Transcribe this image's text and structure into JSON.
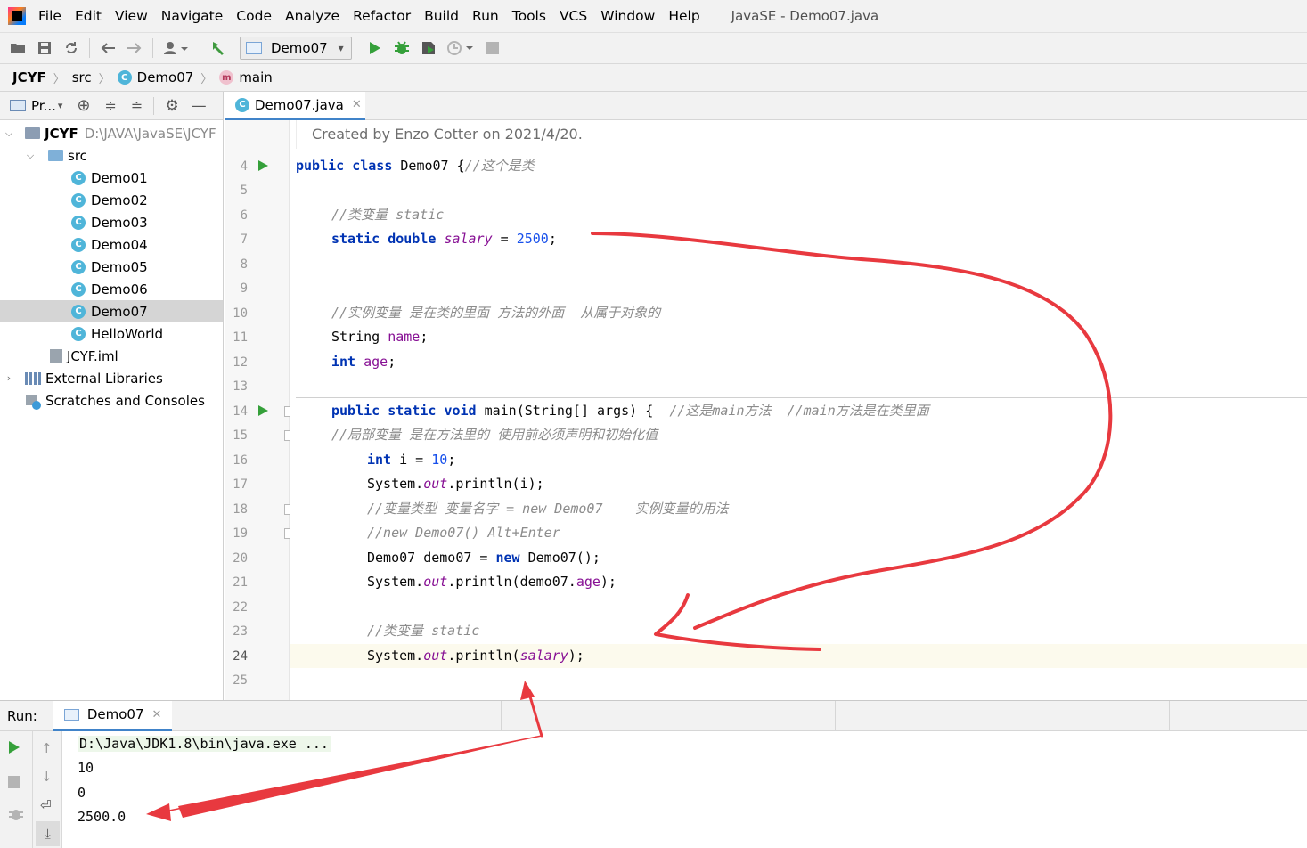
{
  "menubar": {
    "items": [
      "File",
      "Edit",
      "View",
      "Navigate",
      "Code",
      "Analyze",
      "Refactor",
      "Build",
      "Run",
      "Tools",
      "VCS",
      "Window",
      "Help"
    ],
    "window_title": "JavaSE - Demo07.java"
  },
  "toolbar": {
    "run_config": "Demo07"
  },
  "breadcrumb": [
    "JCYF",
    "src",
    "Demo07",
    "main"
  ],
  "project_panel": {
    "title": "Pr...",
    "tree": [
      {
        "label": "JCYF",
        "extra": "D:\\JAVA\\JavaSE\\JCYF",
        "icon": "module-folder-icon",
        "expanded": true
      },
      {
        "label": "src",
        "icon": "source-folder-icon",
        "expanded": true
      },
      {
        "label": "Demo01",
        "icon": "java-class-icon"
      },
      {
        "label": "Demo02",
        "icon": "java-class-icon"
      },
      {
        "label": "Demo03",
        "icon": "java-class-icon"
      },
      {
        "label": "Demo04",
        "icon": "java-class-icon"
      },
      {
        "label": "Demo05",
        "icon": "java-class-icon"
      },
      {
        "label": "Demo06",
        "icon": "java-class-icon"
      },
      {
        "label": "Demo07",
        "icon": "java-class-icon",
        "selected": true
      },
      {
        "label": "HelloWorld",
        "icon": "java-class-icon"
      },
      {
        "label": "JCYF.iml",
        "icon": "iml-file-icon"
      },
      {
        "label": "External Libraries",
        "icon": "library-icon",
        "collapsed": true
      },
      {
        "label": "Scratches and Consoles",
        "icon": "scratches-icon"
      }
    ]
  },
  "editor": {
    "tab": "Demo07.java",
    "credit": "Created by Enzo Cotter on 2021/4/20.",
    "line_numbers": [
      "4",
      "5",
      "6",
      "7",
      "8",
      "9",
      "10",
      "11",
      "12",
      "13",
      "14",
      "15",
      "16",
      "17",
      "18",
      "19",
      "20",
      "21",
      "22",
      "23",
      "24",
      "25"
    ],
    "lines": {
      "l4_kw1": "public",
      "l4_kw2": "class",
      "l4_name": " Demo07 {",
      "l4_cm": "//这个是类",
      "l6_cm": "//类变量 static",
      "l7_kw1": "static",
      "l7_kw2": "double",
      "l7_var": "salary",
      "l7_eq": " = ",
      "l7_num": "2500",
      "l7_end": ";",
      "l10_cm": "//实例变量 是在类的里面 方法的外面  从属于对象的",
      "l11_type": "String ",
      "l11_var": "name",
      "l11_end": ";",
      "l12_kw": "int",
      "l12_var": "age",
      "l12_end": ";",
      "l14_kw1": "public",
      "l14_kw2": "static",
      "l14_kw3": "void",
      "l14_sig": " main(String[] args) {  ",
      "l14_cm": "//这是main方法  //main方法是在类里面",
      "l15_cm": "//局部变量 是在方法里的 使用前必须声明和初始化值",
      "l16_kw": "int",
      "l16_mid": " i = ",
      "l16_num": "10",
      "l16_end": ";",
      "l17_a": "System.",
      "l17_out": "out",
      "l17_b": ".println(i);",
      "l18_cm": "//变量类型 变量名字 = new Demo07    实例变量的用法",
      "l19_cm": "//new Demo07() Alt+Enter",
      "l20_a": "Demo07 demo07 = ",
      "l20_kw": "new",
      "l20_b": " Demo07();",
      "l21_a": "System.",
      "l21_out": "out",
      "l21_b": ".println(demo07.",
      "l21_fld": "age",
      "l21_c": ");",
      "l23_cm": "//类变量 static",
      "l24_a": "System.",
      "l24_out": "out",
      "l24_b": ".println(",
      "l24_var": "salary",
      "l24_c": ");"
    }
  },
  "run_panel": {
    "label": "Run:",
    "tab": "Demo07",
    "console": [
      "D:\\Java\\JDK1.8\\bin\\java.exe ...",
      "10",
      "0",
      "2500.0"
    ]
  },
  "colors": {
    "annotation_red": "#e8393f",
    "keyword": "#0033b3",
    "comment": "#8c8c8c",
    "number": "#1750eb",
    "field": "#871094",
    "run_green": "#35a03a",
    "selection_blue": "#4083c9"
  }
}
